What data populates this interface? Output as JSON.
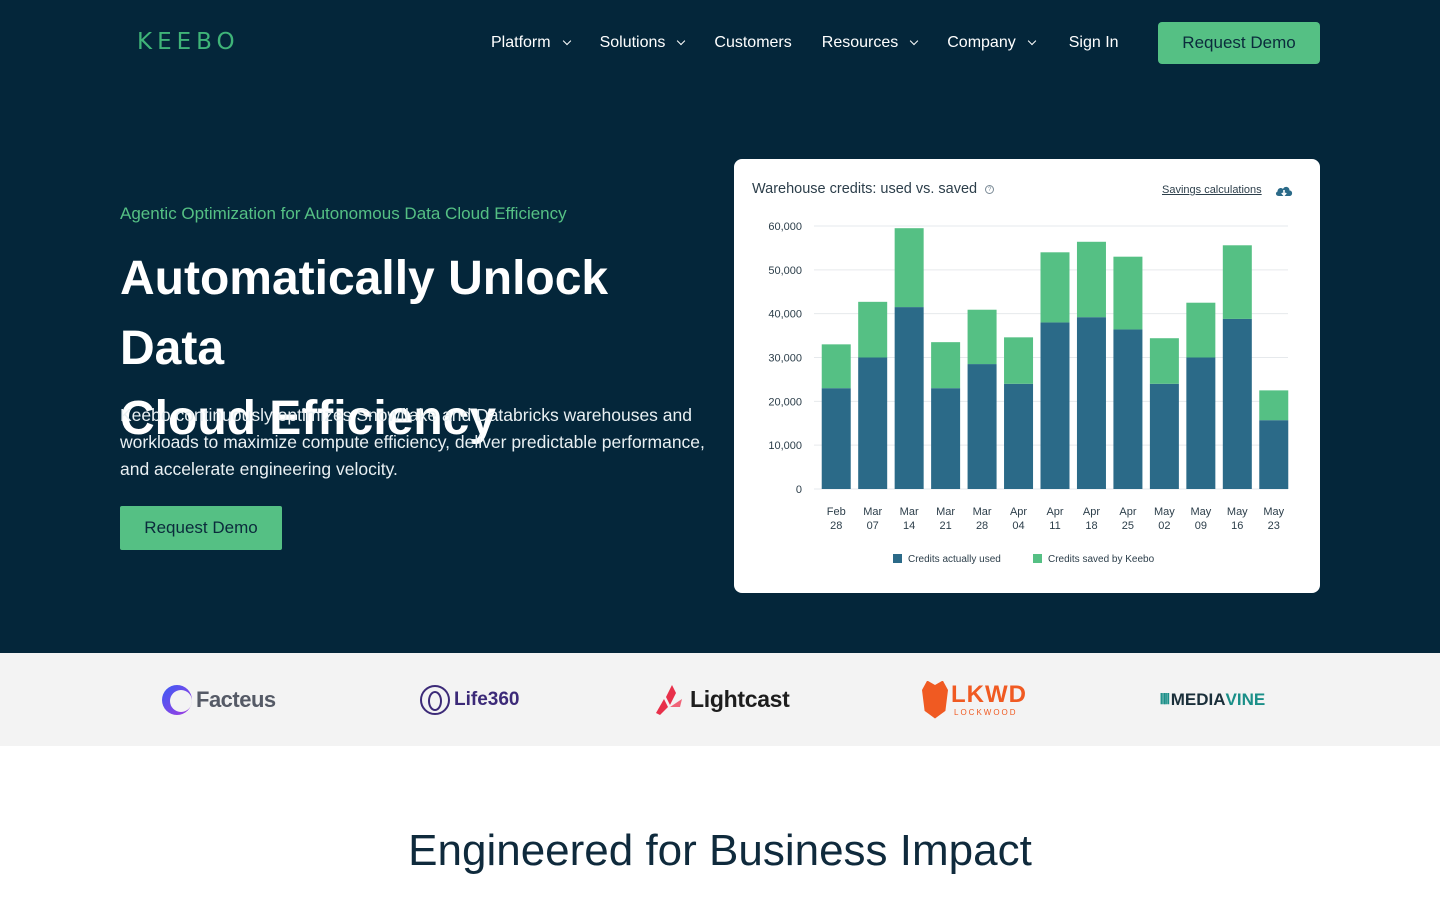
{
  "brand": {
    "logo_text": "KEEBO"
  },
  "nav": {
    "items": [
      {
        "label": "Platform",
        "dropdown": true
      },
      {
        "label": "Solutions",
        "dropdown": true
      },
      {
        "label": "Customers",
        "dropdown": false
      },
      {
        "label": "Resources",
        "dropdown": true
      },
      {
        "label": "Company",
        "dropdown": true
      }
    ],
    "sign_in": "Sign In",
    "cta": "Request Demo"
  },
  "hero": {
    "eyebrow": "Agentic Optimization for Autonomous Data Cloud Efficiency",
    "headline_line1": "Automatically Unlock Data",
    "headline_line2": "Cloud Efficiency",
    "lede": "Keebo continuously optimizes Snowflake and Databricks warehouses and workloads to maximize compute efficiency, deliver predictable performance, and accelerate engineering velocity.",
    "cta": "Request Demo"
  },
  "card": {
    "title": "Warehouse credits: used vs. saved",
    "help_icon": "?",
    "savings_link": "Savings calculations",
    "download_icon": "cloud-download-icon"
  },
  "colors": {
    "background": "#04263a",
    "accent": "#55c084",
    "used": "#2b6a88",
    "saved": "#55c084"
  },
  "chart_data": {
    "type": "bar",
    "stacked": true,
    "title": "Warehouse credits: used vs. saved",
    "categories": [
      "Feb 28",
      "Mar 07",
      "Mar 14",
      "Mar 21",
      "Mar 28",
      "Apr 04",
      "Apr 11",
      "Apr 18",
      "Apr 25",
      "May 02",
      "May 09",
      "May 16",
      "May 23"
    ],
    "series": [
      {
        "name": "Credits actually used",
        "color": "#2b6a88",
        "values": [
          23000,
          30000,
          41500,
          23000,
          28500,
          24000,
          38000,
          39200,
          36400,
          24000,
          30000,
          38800,
          15700
        ]
      },
      {
        "name": "Credits saved by Keebo",
        "color": "#55c084",
        "values": [
          10000,
          12700,
          18000,
          10500,
          12400,
          10600,
          16000,
          17200,
          16600,
          10400,
          12500,
          16800,
          6800
        ]
      }
    ],
    "y_ticks": [
      "0",
      "10,000",
      "20,000",
      "30,000",
      "40,000",
      "50,000",
      "60,000"
    ],
    "ylim": [
      0,
      60000
    ],
    "grid": true,
    "legend": "bottom-center"
  },
  "customers": {
    "logos": [
      {
        "name": "Facteus"
      },
      {
        "name": "Life360"
      },
      {
        "name": "Lightcast"
      },
      {
        "name": "LKWD",
        "sub": "LOCKWOOD"
      },
      {
        "name": "MEDIA",
        "name2": "VINE"
      }
    ]
  },
  "section": {
    "title": "Engineered for Business Impact"
  }
}
